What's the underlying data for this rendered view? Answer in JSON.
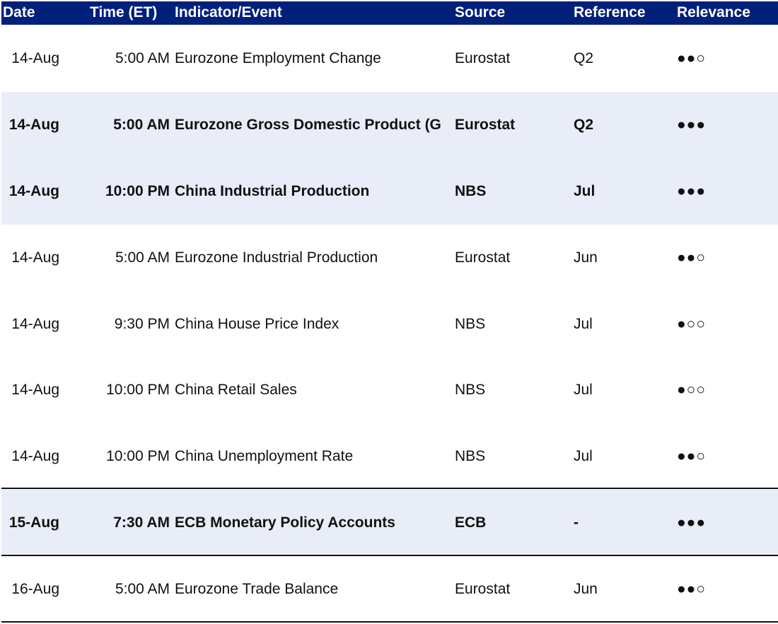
{
  "header": {
    "date": "Date",
    "time": "Time (ET)",
    "event": "Indicator/Event",
    "source": "Source",
    "reference": "Reference",
    "relevance": "Relevance"
  },
  "rows": [
    {
      "date": "14-Aug",
      "time": "5:00 AM",
      "event": "Eurozone Employment Change",
      "source": "Eurostat",
      "reference": "Q2",
      "relevance": "●●○",
      "highlighted": false,
      "bold": false
    },
    {
      "date": "14-Aug",
      "time": "5:00 AM",
      "event": "Eurozone Gross Domestic Product (G",
      "source": "Eurostat",
      "reference": "Q2",
      "relevance": "●●●",
      "highlighted": true,
      "bold": true
    },
    {
      "date": "14-Aug",
      "time": "10:00 PM",
      "event": "China Industrial Production",
      "source": "NBS",
      "reference": "Jul",
      "relevance": "●●●",
      "highlighted": true,
      "bold": true
    },
    {
      "date": "14-Aug",
      "time": "5:00 AM",
      "event": "Eurozone Industrial Production",
      "source": "Eurostat",
      "reference": "Jun",
      "relevance": "●●○",
      "highlighted": false,
      "bold": false
    },
    {
      "date": "14-Aug",
      "time": "9:30 PM",
      "event": "China House Price Index",
      "source": "NBS",
      "reference": "Jul",
      "relevance": "●○○",
      "highlighted": false,
      "bold": false
    },
    {
      "date": "14-Aug",
      "time": "10:00 PM",
      "event": "China Retail Sales",
      "source": "NBS",
      "reference": "Jul",
      "relevance": "●○○",
      "highlighted": false,
      "bold": false
    },
    {
      "date": "14-Aug",
      "time": "10:00 PM",
      "event": "China Unemployment Rate",
      "source": "NBS",
      "reference": "Jul",
      "relevance": "●●○",
      "highlighted": false,
      "bold": false
    },
    {
      "date": "15-Aug",
      "time": "7:30 AM",
      "event": "ECB Monetary Policy Accounts",
      "source": "ECB",
      "reference": "-",
      "relevance": "●●●",
      "highlighted": true,
      "bold": true
    },
    {
      "date": "16-Aug",
      "time": "5:00 AM",
      "event": "Eurozone Trade Balance",
      "source": "Eurostat",
      "reference": "Jun",
      "relevance": "●●○",
      "highlighted": false,
      "bold": false
    }
  ],
  "colors": {
    "header_bg": "#00207a",
    "header_text": "#ffffff",
    "highlight_bg": "#e8edf7",
    "divider": "#111111"
  }
}
